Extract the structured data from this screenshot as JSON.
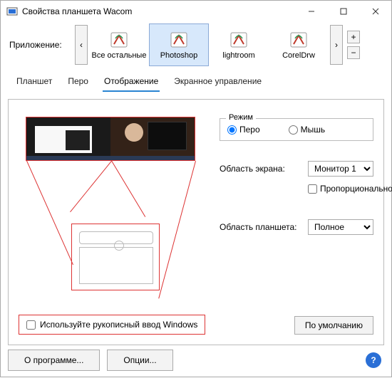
{
  "window": {
    "title": "Свойства планшета Wacom"
  },
  "app_row": {
    "label": "Приложение:",
    "items": [
      {
        "name": "Все остальные"
      },
      {
        "name": "Photoshop"
      },
      {
        "name": "lightroom"
      },
      {
        "name": "CorelDrw"
      }
    ],
    "selected_index": 1
  },
  "tabs": {
    "items": [
      "Планшет",
      "Перо",
      "Отображение",
      "Экранное управление"
    ],
    "active_index": 2
  },
  "mode": {
    "legend": "Режим",
    "pen": "Перо",
    "mouse": "Мышь",
    "selected": "pen"
  },
  "screen_area": {
    "label": "Область экрана:",
    "value": "Монитор 1"
  },
  "proportional": {
    "label": "Пропорциональное",
    "checked": false
  },
  "tablet_area": {
    "label": "Область планшета:",
    "value": "Полное"
  },
  "handwriting": {
    "label": "Используйте рукописный ввод Windows",
    "checked": false
  },
  "buttons": {
    "default": "По умолчанию",
    "about": "О программе...",
    "options": "Опции..."
  },
  "glyphs": {
    "left": "‹",
    "right": "›",
    "plus": "+",
    "minus": "−",
    "help": "?"
  }
}
